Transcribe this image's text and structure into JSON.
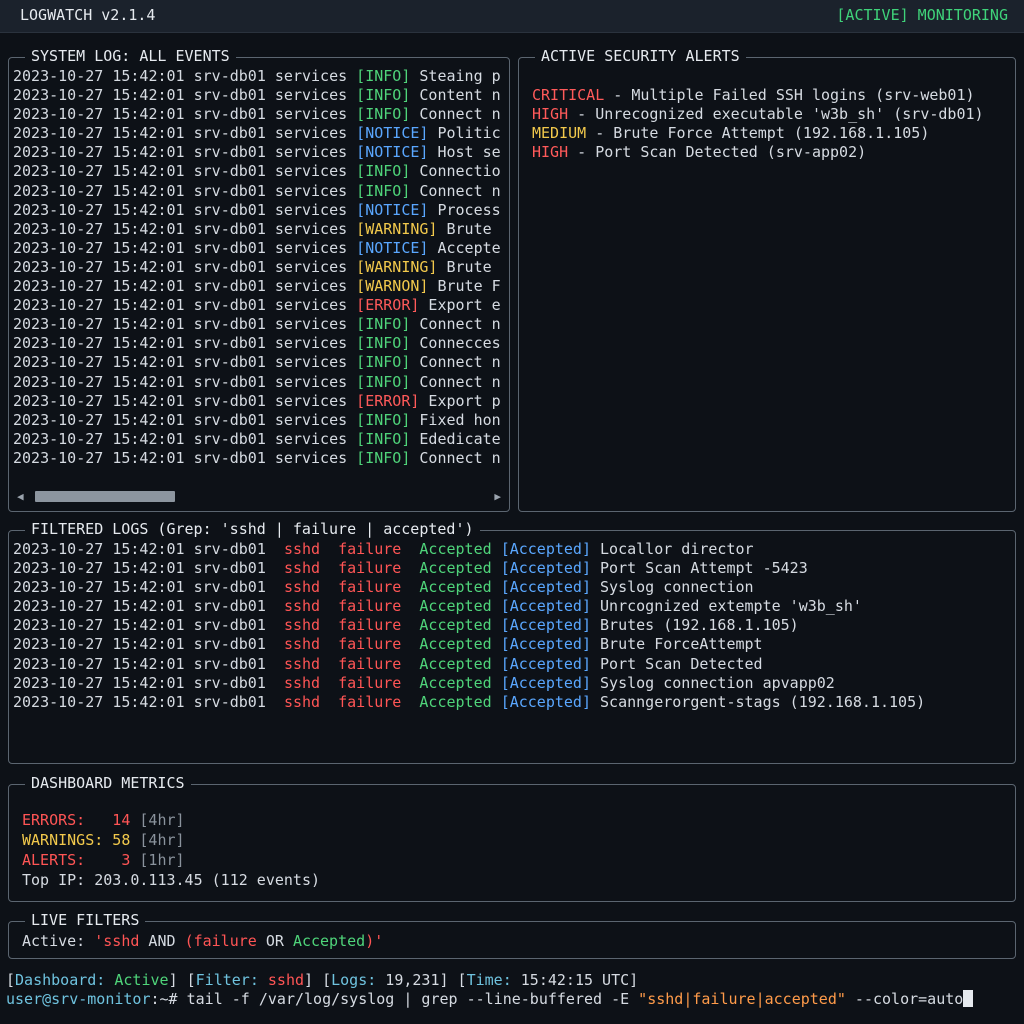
{
  "titlebar": {
    "app": "LOGWATCH v2.1.4",
    "status": "[ACTIVE] MONITORING"
  },
  "system_log": {
    "title": "SYSTEM LOG: ALL EVENTS",
    "prefix": "2023-10-27 15:42:01 srv-db01 services ",
    "lines": [
      {
        "level": "[INFO]",
        "kind": "info",
        "msg": " Steaing p"
      },
      {
        "level": "[INFO]",
        "kind": "info",
        "msg": " Content n"
      },
      {
        "level": "[INFO]",
        "kind": "info",
        "msg": " Connect n"
      },
      {
        "level": "[NOTICE]",
        "kind": "notice",
        "msg": " Politic"
      },
      {
        "level": "[NOTICE]",
        "kind": "notice",
        "msg": " Host se"
      },
      {
        "level": "[INFO]",
        "kind": "info",
        "msg": " Connectio"
      },
      {
        "level": "[INFO]",
        "kind": "info",
        "msg": " Connect n"
      },
      {
        "level": "[NOTICE]",
        "kind": "notice",
        "msg": " Process"
      },
      {
        "level": "[WARNING]",
        "kind": "warning",
        "msg": " Brute"
      },
      {
        "level": "[NOTICE]",
        "kind": "notice",
        "msg": " Accepte"
      },
      {
        "level": "[WARNING]",
        "kind": "warning",
        "msg": " Brute"
      },
      {
        "level": "[WARNON]",
        "kind": "warning",
        "msg": " Brute F"
      },
      {
        "level": "[ERROR]",
        "kind": "error",
        "msg": " Export e"
      },
      {
        "level": "[INFO]",
        "kind": "info",
        "msg": " Connect n"
      },
      {
        "level": "[INFO]",
        "kind": "info",
        "msg": " Connecces"
      },
      {
        "level": "[INFO]",
        "kind": "info",
        "msg": " Connect n"
      },
      {
        "level": "[INFO]",
        "kind": "info",
        "msg": " Connect n"
      },
      {
        "level": "[ERROR]",
        "kind": "error",
        "msg": " Export p"
      },
      {
        "level": "[INFO]",
        "kind": "info",
        "msg": " Fixed hon"
      },
      {
        "level": "[INFO]",
        "kind": "info",
        "msg": " Ededicate"
      },
      {
        "level": "[INFO]",
        "kind": "info",
        "msg": " Connect n"
      }
    ],
    "scroll_left": "◀",
    "scroll_right": "▶"
  },
  "alerts": {
    "title": "ACTIVE SECURITY ALERTS",
    "items": [
      {
        "severity": "CRITICAL",
        "kind": "critical",
        "text": " - Multiple Failed SSH logins (srv-web01)"
      },
      {
        "severity": "HIGH",
        "kind": "error",
        "text": " - Unrecognized executable 'w3b_sh' (srv-db01)"
      },
      {
        "severity": "MEDIUM",
        "kind": "warning",
        "text": " - Brute Force Attempt (192.168.1.105)"
      },
      {
        "severity": "HIGH",
        "kind": "error",
        "text": " - Port Scan Detected (srv-app02)"
      }
    ]
  },
  "filtered": {
    "title": "FILTERED LOGS (Grep: 'sshd | failure | accepted')",
    "prefix": "2023-10-27 15:42:01 srv-db01  ",
    "sshd": "sshd",
    "failure": "failure",
    "accepted": "Accepted",
    "tag": "[Accepted]",
    "lines": [
      "Locallor director",
      "Port Scan Attempt -5423",
      "Syslog connection",
      "Unrcognized extempte 'w3b_sh'",
      "Brutes (192.168.1.105)",
      "Brute ForceAttempt",
      "Port Scan Detected",
      "Syslog connection apvapp02",
      "Scanngerorgent-stags (192.168.1.105)"
    ]
  },
  "metrics": {
    "title": "DASHBOARD METRICS",
    "errors_label": "ERRORS:  ",
    "errors_value": " 14",
    "errors_window": " [4hr]",
    "warnings_label": "WARNINGS:",
    "warnings_value": " 58",
    "warnings_window": " [4hr]",
    "alerts_label": "ALERTS:  ",
    "alerts_value": "  3",
    "alerts_window": " [1hr]",
    "top_ip": "Top IP: 203.0.113.45 (112 events)"
  },
  "live_filters": {
    "title": "LIVE FILTERS",
    "label": "Active: ",
    "q1": "'sshd",
    "and": " AND ",
    "q2": "(failure",
    "or": " OR ",
    "q3": "Accepted",
    "q4": ")'"
  },
  "status": {
    "open1": "[",
    "dash_label": "Dashboard:",
    "dash_value": " Active",
    "sep1": "] [",
    "filter_label": "Filter:",
    "filter_value": " sshd",
    "sep2": "] [",
    "logs_label": "Logs:",
    "logs_value": " 19,231",
    "sep3": "] [",
    "time_label": "Time:",
    "time_value": " 15:42:15 UTC",
    "close": "]"
  },
  "prompt": {
    "user": "user@srv-monitor",
    "path": ":~# ",
    "cmd": "tail -f /var/log/syslog | grep --line-buffered -E ",
    "pattern": "\"sshd|failure|accepted\"",
    "flag": " --color=auto"
  }
}
